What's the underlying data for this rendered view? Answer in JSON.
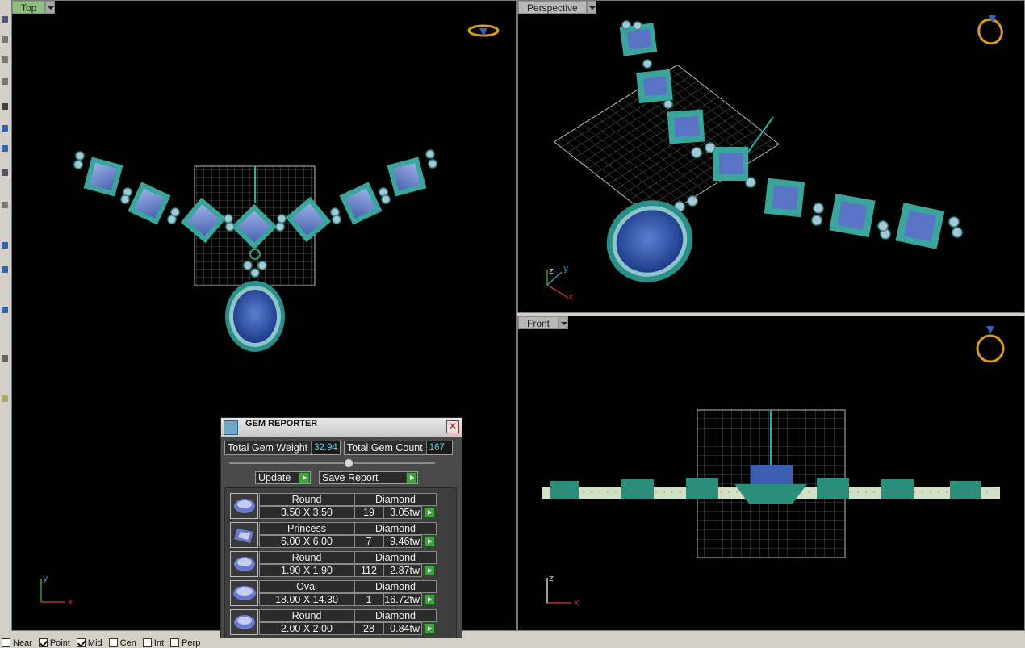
{
  "viewports": {
    "top": {
      "label": "Top"
    },
    "perspective": {
      "label": "Perspective"
    },
    "front": {
      "label": "Front"
    }
  },
  "axes": {
    "x": "x",
    "y": "y",
    "z": "z"
  },
  "gem_reporter": {
    "title": "GEM REPORTER",
    "close_label": "✕",
    "total_weight_label": "Total Gem Weight",
    "total_weight_value": "32.94",
    "total_count_label": "Total Gem Count",
    "total_count_value": "167",
    "update_label": "Update",
    "save_report_label": "Save Report",
    "gems": [
      {
        "shape": "Round",
        "material": "Diamond",
        "size": "3.50 X 3.50",
        "count": "19",
        "weight": "3.05tw",
        "icon": "round-gem-icon"
      },
      {
        "shape": "Princess",
        "material": "Diamond",
        "size": "6.00 X 6.00",
        "count": "7",
        "weight": "9.46tw",
        "icon": "princess-gem-icon"
      },
      {
        "shape": "Round",
        "material": "Diamond",
        "size": "1.90 X 1.90",
        "count": "112",
        "weight": "2.87tw",
        "icon": "round-gem-icon"
      },
      {
        "shape": "Oval",
        "material": "Diamond",
        "size": "18.00 X 14.30",
        "count": "1",
        "weight": "16.72tw",
        "icon": "oval-gem-icon"
      },
      {
        "shape": "Round",
        "material": "Diamond",
        "size": "2.00 X 2.00",
        "count": "28",
        "weight": "0.84tw",
        "icon": "round-gem-icon"
      }
    ]
  },
  "statusbar": {
    "snaps": [
      {
        "label": "Near",
        "checked": false
      },
      {
        "label": "Point",
        "checked": true
      },
      {
        "label": "Mid",
        "checked": true
      },
      {
        "label": "Cen",
        "checked": false
      },
      {
        "label": "Int",
        "checked": false
      },
      {
        "label": "Perp",
        "checked": false
      }
    ]
  }
}
